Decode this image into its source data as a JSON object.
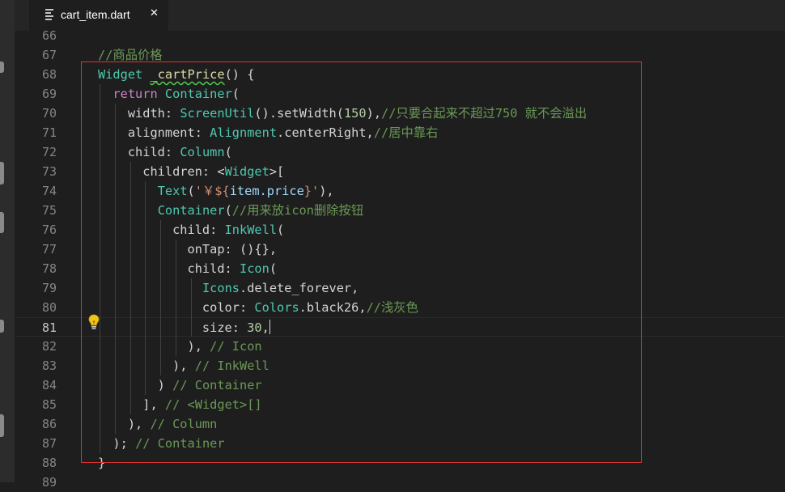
{
  "tab": {
    "filename": "cart_item.dart",
    "close_glyph": "✕",
    "icon": "file-lines-icon"
  },
  "active_line": "81",
  "lines": [
    {
      "n": "66",
      "tokens": []
    },
    {
      "n": "67",
      "tokens": [
        {
          "c": "t-c",
          "t": "//商品价格"
        }
      ]
    },
    {
      "n": "68",
      "tokens": [
        {
          "c": "t-t",
          "t": "Widget"
        },
        {
          "c": "t-p",
          "t": " "
        },
        {
          "c": "t-f t-squig",
          "t": "_cartPrice"
        },
        {
          "c": "t-p",
          "t": "() {"
        }
      ]
    },
    {
      "n": "69",
      "tokens": [
        {
          "c": "t-p",
          "t": "  "
        },
        {
          "c": "t-k",
          "t": "return"
        },
        {
          "c": "t-p",
          "t": " "
        },
        {
          "c": "t-t",
          "t": "Container"
        },
        {
          "c": "t-p",
          "t": "("
        }
      ]
    },
    {
      "n": "70",
      "tokens": [
        {
          "c": "t-p",
          "t": "    width: "
        },
        {
          "c": "t-t",
          "t": "ScreenUtil"
        },
        {
          "c": "t-p",
          "t": "()."
        },
        {
          "c": "t-p",
          "t": "setWidth"
        },
        {
          "c": "t-p",
          "t": "("
        },
        {
          "c": "t-n",
          "t": "150"
        },
        {
          "c": "t-p",
          "t": "),"
        },
        {
          "c": "t-c",
          "t": "//只要合起来不超过750 就不会溢出"
        }
      ]
    },
    {
      "n": "71",
      "tokens": [
        {
          "c": "t-p",
          "t": "    alignment: "
        },
        {
          "c": "t-t",
          "t": "Alignment"
        },
        {
          "c": "t-p",
          "t": ".centerRight,"
        },
        {
          "c": "t-c",
          "t": "//居中靠右"
        }
      ]
    },
    {
      "n": "72",
      "tokens": [
        {
          "c": "t-p",
          "t": "    child: "
        },
        {
          "c": "t-t",
          "t": "Column"
        },
        {
          "c": "t-p",
          "t": "("
        }
      ]
    },
    {
      "n": "73",
      "tokens": [
        {
          "c": "t-p",
          "t": "      children: <"
        },
        {
          "c": "t-t",
          "t": "Widget"
        },
        {
          "c": "t-p",
          "t": ">["
        }
      ]
    },
    {
      "n": "74",
      "tokens": [
        {
          "c": "t-p",
          "t": "        "
        },
        {
          "c": "t-t",
          "t": "Text"
        },
        {
          "c": "t-p",
          "t": "("
        },
        {
          "c": "t-s",
          "t": "'￥${"
        },
        {
          "c": "t-v",
          "t": "item.price"
        },
        {
          "c": "t-s",
          "t": "}'"
        },
        {
          "c": "t-p",
          "t": "),"
        }
      ]
    },
    {
      "n": "75",
      "tokens": [
        {
          "c": "t-p",
          "t": "        "
        },
        {
          "c": "t-t",
          "t": "Container"
        },
        {
          "c": "t-p",
          "t": "("
        },
        {
          "c": "t-c",
          "t": "//用来放icon删除按钮"
        }
      ]
    },
    {
      "n": "76",
      "tokens": [
        {
          "c": "t-p",
          "t": "          child: "
        },
        {
          "c": "t-t",
          "t": "InkWell"
        },
        {
          "c": "t-p",
          "t": "("
        }
      ]
    },
    {
      "n": "77",
      "tokens": [
        {
          "c": "t-p",
          "t": "            onTap: (){},"
        }
      ]
    },
    {
      "n": "78",
      "tokens": [
        {
          "c": "t-p",
          "t": "            child: "
        },
        {
          "c": "t-t",
          "t": "Icon"
        },
        {
          "c": "t-p",
          "t": "("
        }
      ]
    },
    {
      "n": "79",
      "tokens": [
        {
          "c": "t-p",
          "t": "              "
        },
        {
          "c": "t-t",
          "t": "Icons"
        },
        {
          "c": "t-p",
          "t": ".delete_forever,"
        }
      ]
    },
    {
      "n": "80",
      "tokens": [
        {
          "c": "t-p",
          "t": "              color: "
        },
        {
          "c": "t-t",
          "t": "Colors"
        },
        {
          "c": "t-p",
          "t": ".black26,"
        },
        {
          "c": "t-c",
          "t": "//浅灰色"
        }
      ]
    },
    {
      "n": "81",
      "tokens": [
        {
          "c": "t-p",
          "t": "              size: "
        },
        {
          "c": "t-n",
          "t": "30"
        },
        {
          "c": "t-p",
          "t": ","
        }
      ]
    },
    {
      "n": "82",
      "tokens": [
        {
          "c": "t-p",
          "t": "            ), "
        },
        {
          "c": "t-c",
          "t": "// Icon"
        }
      ]
    },
    {
      "n": "83",
      "tokens": [
        {
          "c": "t-p",
          "t": "          ), "
        },
        {
          "c": "t-c",
          "t": "// InkWell"
        }
      ]
    },
    {
      "n": "84",
      "tokens": [
        {
          "c": "t-p",
          "t": "        ) "
        },
        {
          "c": "t-c",
          "t": "// Container"
        }
      ]
    },
    {
      "n": "85",
      "tokens": [
        {
          "c": "t-p",
          "t": "      ], "
        },
        {
          "c": "t-c",
          "t": "// <Widget>[]"
        }
      ]
    },
    {
      "n": "86",
      "tokens": [
        {
          "c": "t-p",
          "t": "    ), "
        },
        {
          "c": "t-c",
          "t": "// Column"
        }
      ]
    },
    {
      "n": "87",
      "tokens": [
        {
          "c": "t-p",
          "t": "  ); "
        },
        {
          "c": "t-c",
          "t": "// Container"
        }
      ]
    },
    {
      "n": "88",
      "tokens": [
        {
          "c": "t-p",
          "t": "}"
        }
      ]
    },
    {
      "n": "89",
      "tokens": []
    }
  ],
  "colors": {
    "annotation_box": "#e03131",
    "lightbulb": "#f0c419"
  }
}
